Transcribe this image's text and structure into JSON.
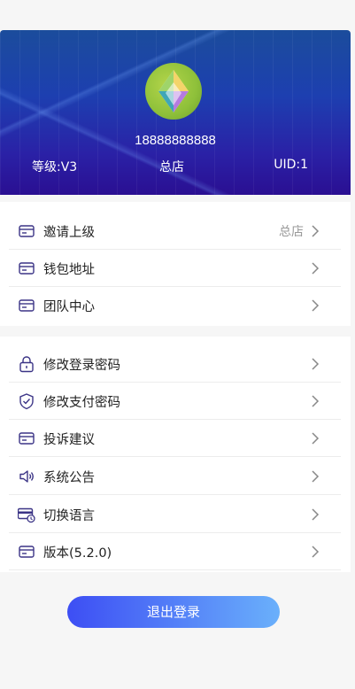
{
  "profile": {
    "phone": "18888888888",
    "level": "等级:V3",
    "store": "总店",
    "uid": "UID:1"
  },
  "menu_group_1": [
    {
      "label": "邀请上级",
      "value": "总店",
      "icon": "card-icon"
    },
    {
      "label": "钱包地址",
      "value": "",
      "icon": "card-icon"
    },
    {
      "label": "团队中心",
      "value": "",
      "icon": "card-icon"
    }
  ],
  "menu_group_2": [
    {
      "label": "修改登录密码",
      "icon": "lock-icon"
    },
    {
      "label": "修改支付密码",
      "icon": "shield-icon"
    },
    {
      "label": "投诉建议",
      "icon": "card-icon"
    },
    {
      "label": "系统公告",
      "icon": "speaker-icon"
    },
    {
      "label": "切换语言",
      "icon": "credit-card-clock-icon"
    },
    {
      "label": "版本(5.2.0)",
      "icon": "card-icon"
    }
  ],
  "logout_label": "退出登录",
  "colors": {
    "header_top": "#1b4c9c",
    "header_bottom": "#2a0f92",
    "icon_color": "#3b3486",
    "button_start": "#3d4ef4",
    "button_end": "#6ab0fb"
  }
}
